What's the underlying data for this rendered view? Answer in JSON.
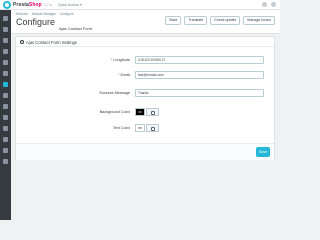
{
  "topbar": {
    "brand_prefix": "Presta",
    "brand_suffix": "Shop",
    "version": "1.7.x",
    "quick_access": "Quick Access ▾"
  },
  "sidebar": {
    "icons": [
      "dashboard-icon",
      "orders-icon",
      "catalog-icon",
      "customers-icon",
      "messages-icon",
      "stats-icon",
      "modules-icon",
      "design-icon",
      "shipping-icon",
      "payment-icon",
      "international-icon",
      "params-icon",
      "advanced-icon",
      "settings-icon"
    ],
    "active_index": 6
  },
  "header": {
    "breadcrumbs": [
      "Modules",
      "Module Manager",
      "Configure"
    ],
    "title": "Configure",
    "subtitle": "Ajax Contact Form",
    "buttons": [
      "Back",
      "Translate",
      "Check update",
      "Manage hooks"
    ]
  },
  "panel": {
    "title": "Ajax Contact Form Settings",
    "fields": {
      "longitude": {
        "label": "Longitude",
        "value": "0.00422 000000.27"
      },
      "email": {
        "label": "Email",
        "value": "test@domain.com"
      },
      "success_message": {
        "label": "Success Message",
        "value": "Thanks"
      },
      "background_color": {
        "label": "Background Color",
        "value": "#3"
      },
      "text_color": {
        "label": "Text Color",
        "value": "#fff"
      }
    },
    "save_label": "Save"
  },
  "colors": {
    "accent": "#25b9d7",
    "sidebar": "#363a41",
    "background_swatch": "#000000",
    "text_swatch": "#ffffff"
  }
}
